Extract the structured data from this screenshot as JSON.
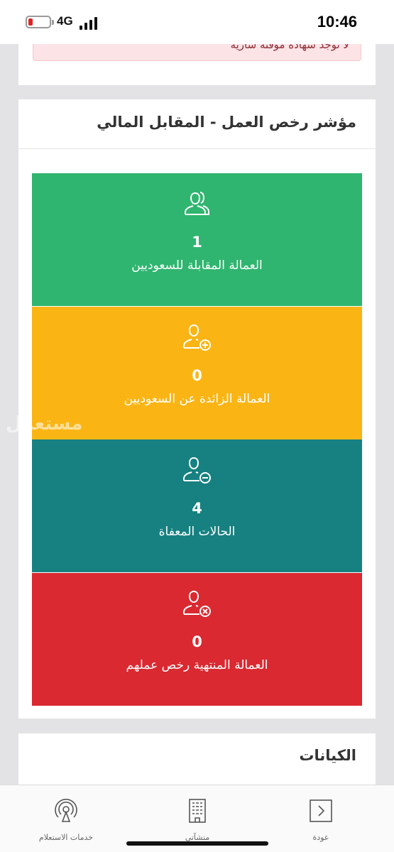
{
  "status_bar": {
    "time": "10:46",
    "network": "4G",
    "battery_color": "#e02424"
  },
  "alert": {
    "text": "لا توجد شهادة مؤقتة سارية"
  },
  "indicator_card": {
    "title": "مؤشر رخص العمل - المقابل المالي",
    "tiles": [
      {
        "icon": "users-icon",
        "count": "1",
        "label": "العمالة المقابلة للسعوديين",
        "color": "#2fb56f"
      },
      {
        "icon": "user-plus-icon",
        "count": "0",
        "label": "العمالة الزائدة عن السعوديين",
        "color": "#fab515"
      },
      {
        "icon": "user-minus-icon",
        "count": "4",
        "label": "الحالات المعفاة",
        "color": "#178181"
      },
      {
        "icon": "user-x-icon",
        "count": "0",
        "label": "العمالة المنتهية رخص عملهم",
        "color": "#da2931"
      }
    ]
  },
  "entities_card": {
    "title": "الكيانات"
  },
  "watermark": "مستعمل",
  "bottom_nav": {
    "items": [
      {
        "icon": "chevron-right-icon",
        "label": "عودة"
      },
      {
        "icon": "building-icon",
        "label": "منشآتي"
      },
      {
        "icon": "broadcast-icon",
        "label": "خدمات الاستعلام"
      }
    ]
  }
}
